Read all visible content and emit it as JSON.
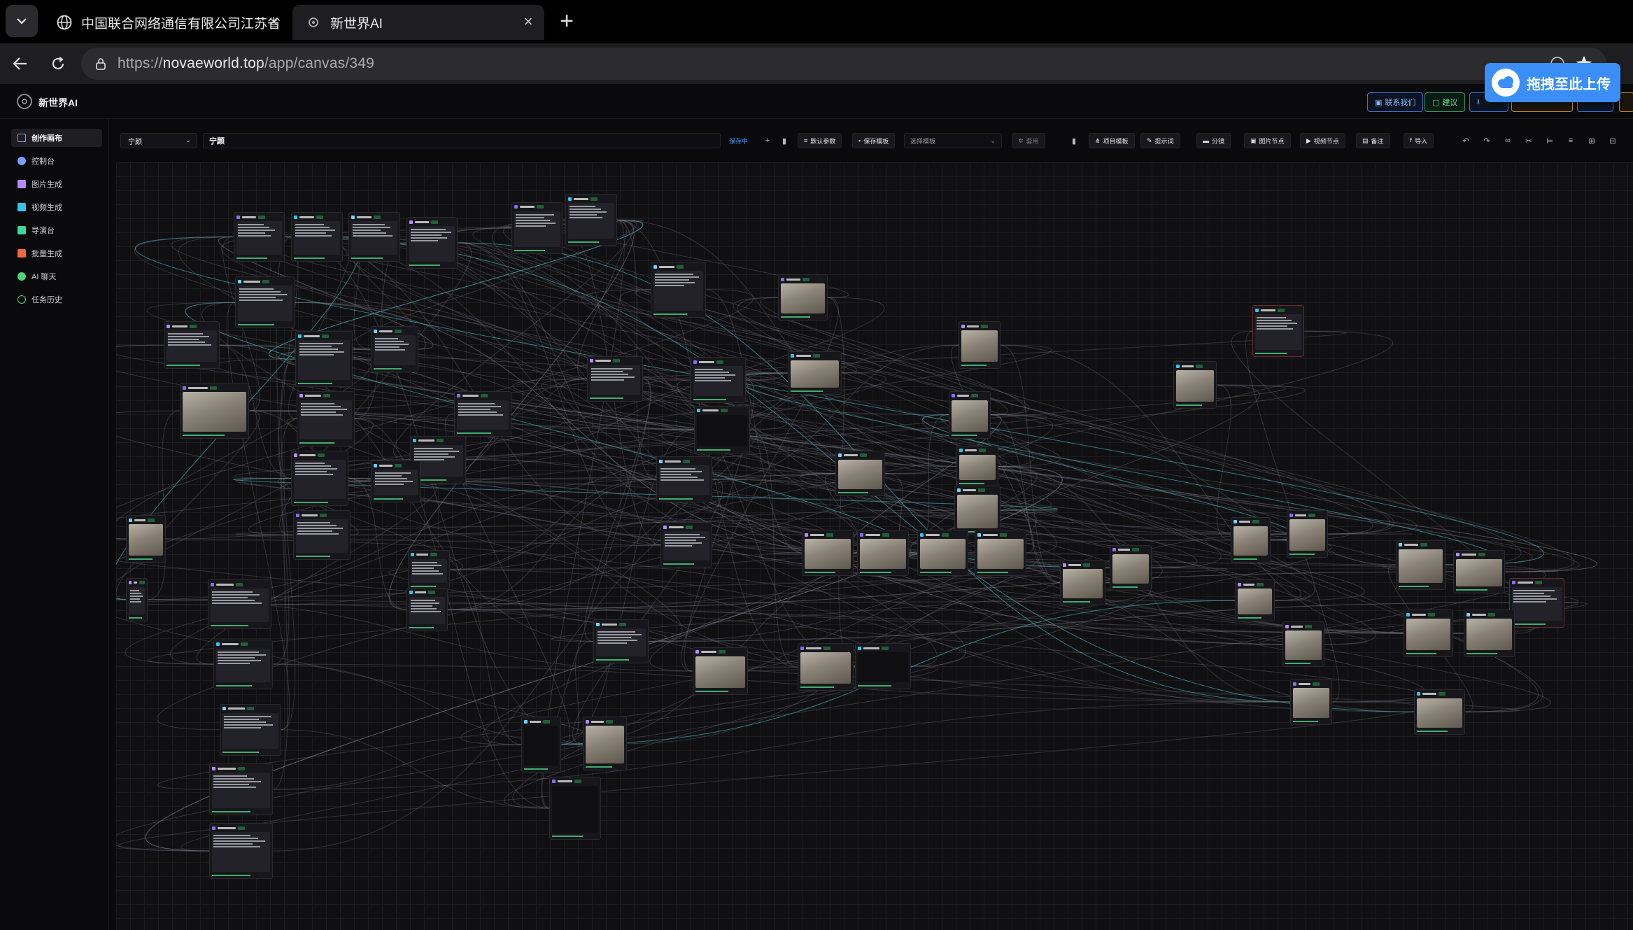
{
  "browser": {
    "tabs": [
      {
        "title": "中国联合网络通信有限公司江苏省",
        "icon": "globe-icon"
      },
      {
        "title": "新世界AI",
        "icon": "gear-icon"
      }
    ],
    "url_prefix": "https://",
    "url_host": "novaeworld.top",
    "url_path": "/app/canvas/349"
  },
  "upload_badge": {
    "label": "拖拽至此上传",
    "icon": "baidu-cloud-icon"
  },
  "app": {
    "name": "新世界AI",
    "header_buttons": [
      {
        "label": "联系我们",
        "color": "#7fb2ff"
      },
      {
        "label": "建议",
        "color": "#5de08c"
      }
    ],
    "sidebar": [
      {
        "label": "创作画布",
        "color": "#7aa2ff"
      },
      {
        "label": "控制台",
        "color": "#7a9dff"
      },
      {
        "label": "图片生成",
        "color": "#b58cff"
      },
      {
        "label": "视频生成",
        "color": "#33c4e8"
      },
      {
        "label": "导演台",
        "color": "#3fd4a0"
      },
      {
        "label": "批量生成",
        "color": "#f2673b"
      },
      {
        "label": "AI 聊天",
        "color": "#4ed37a"
      },
      {
        "label": "任务历史",
        "color": "#4ed37a"
      }
    ],
    "toolbar": {
      "project_select": "宁颜",
      "project_name": "宁颜",
      "save_status": "保存中",
      "default_params": "默认参数",
      "save_template": "保存模板",
      "template_placeholder": "选择模板",
      "apply": "套用",
      "project_template": "项目模板",
      "prompt": "提示词",
      "storyboard": "分镜",
      "image_node": "图片节点",
      "video_node": "视频节点",
      "note": "备注",
      "import": "导入"
    }
  }
}
